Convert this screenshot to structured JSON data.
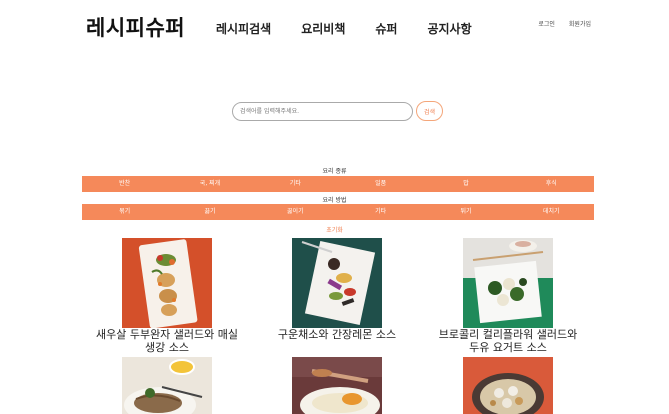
{
  "header": {
    "logo": "레시피슈퍼",
    "nav": [
      "레시피검색",
      "요리비책",
      "슈퍼",
      "공지사항"
    ],
    "util": [
      "로그인",
      "회원가입"
    ]
  },
  "search": {
    "placeholder": "검색어를 입력해주세요.",
    "button": "검색"
  },
  "filters": {
    "type_label": "요리 종류",
    "types": [
      "반찬",
      "국, 찌개",
      "기타",
      "일품",
      "밥",
      "후식"
    ],
    "method_label": "요리 방법",
    "methods": [
      "볶기",
      "끓기",
      "끓이기",
      "기타",
      "튀기",
      "데치기"
    ],
    "reset": "초기화"
  },
  "recipes": [
    {
      "title_line1": "새우살 두부완자 샐러드와 매실",
      "title_line2": "생강 소스"
    },
    {
      "title_line1": "구운채소와 간장레몬 소스",
      "title_line2": ""
    },
    {
      "title_line1": "브로콜리 컬리플라워 샐러드와",
      "title_line2": "두유 요거트 소스"
    },
    {
      "title_line1": "",
      "title_line2": ""
    },
    {
      "title_line1": "",
      "title_line2": ""
    },
    {
      "title_line1": "",
      "title_line2": ""
    }
  ],
  "colors": {
    "accent": "#f5895a",
    "accent_text": "#f08050"
  }
}
